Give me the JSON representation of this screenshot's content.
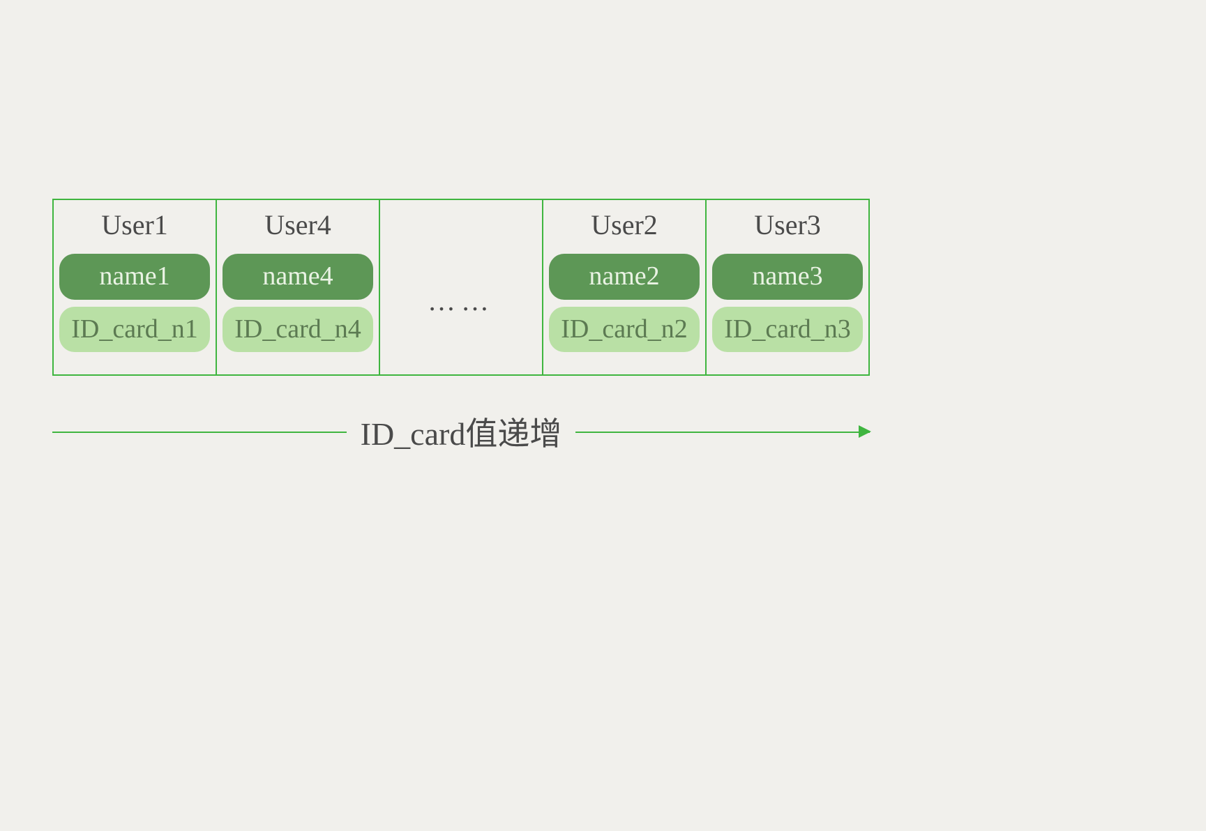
{
  "cells": [
    {
      "user": "User1",
      "name": "name1",
      "id": "ID_card_n1",
      "kind": "data"
    },
    {
      "user": "User4",
      "name": "name4",
      "id": "ID_card_n4",
      "kind": "data"
    },
    {
      "ellipsis": "……",
      "kind": "ellipsis"
    },
    {
      "user": "User2",
      "name": "name2",
      "id": "ID_card_n2",
      "kind": "data"
    },
    {
      "user": "User3",
      "name": "name3",
      "id": "ID_card_n3",
      "kind": "data"
    }
  ],
  "arrow_label": "ID_card值递增",
  "colors": {
    "border": "#3fb53f",
    "pill_dark_bg": "#5d9756",
    "pill_dark_fg": "#eaf3e4",
    "pill_light_bg": "#b9e0a5",
    "pill_light_fg": "#5c7a52",
    "background": "#f1f0ec"
  }
}
